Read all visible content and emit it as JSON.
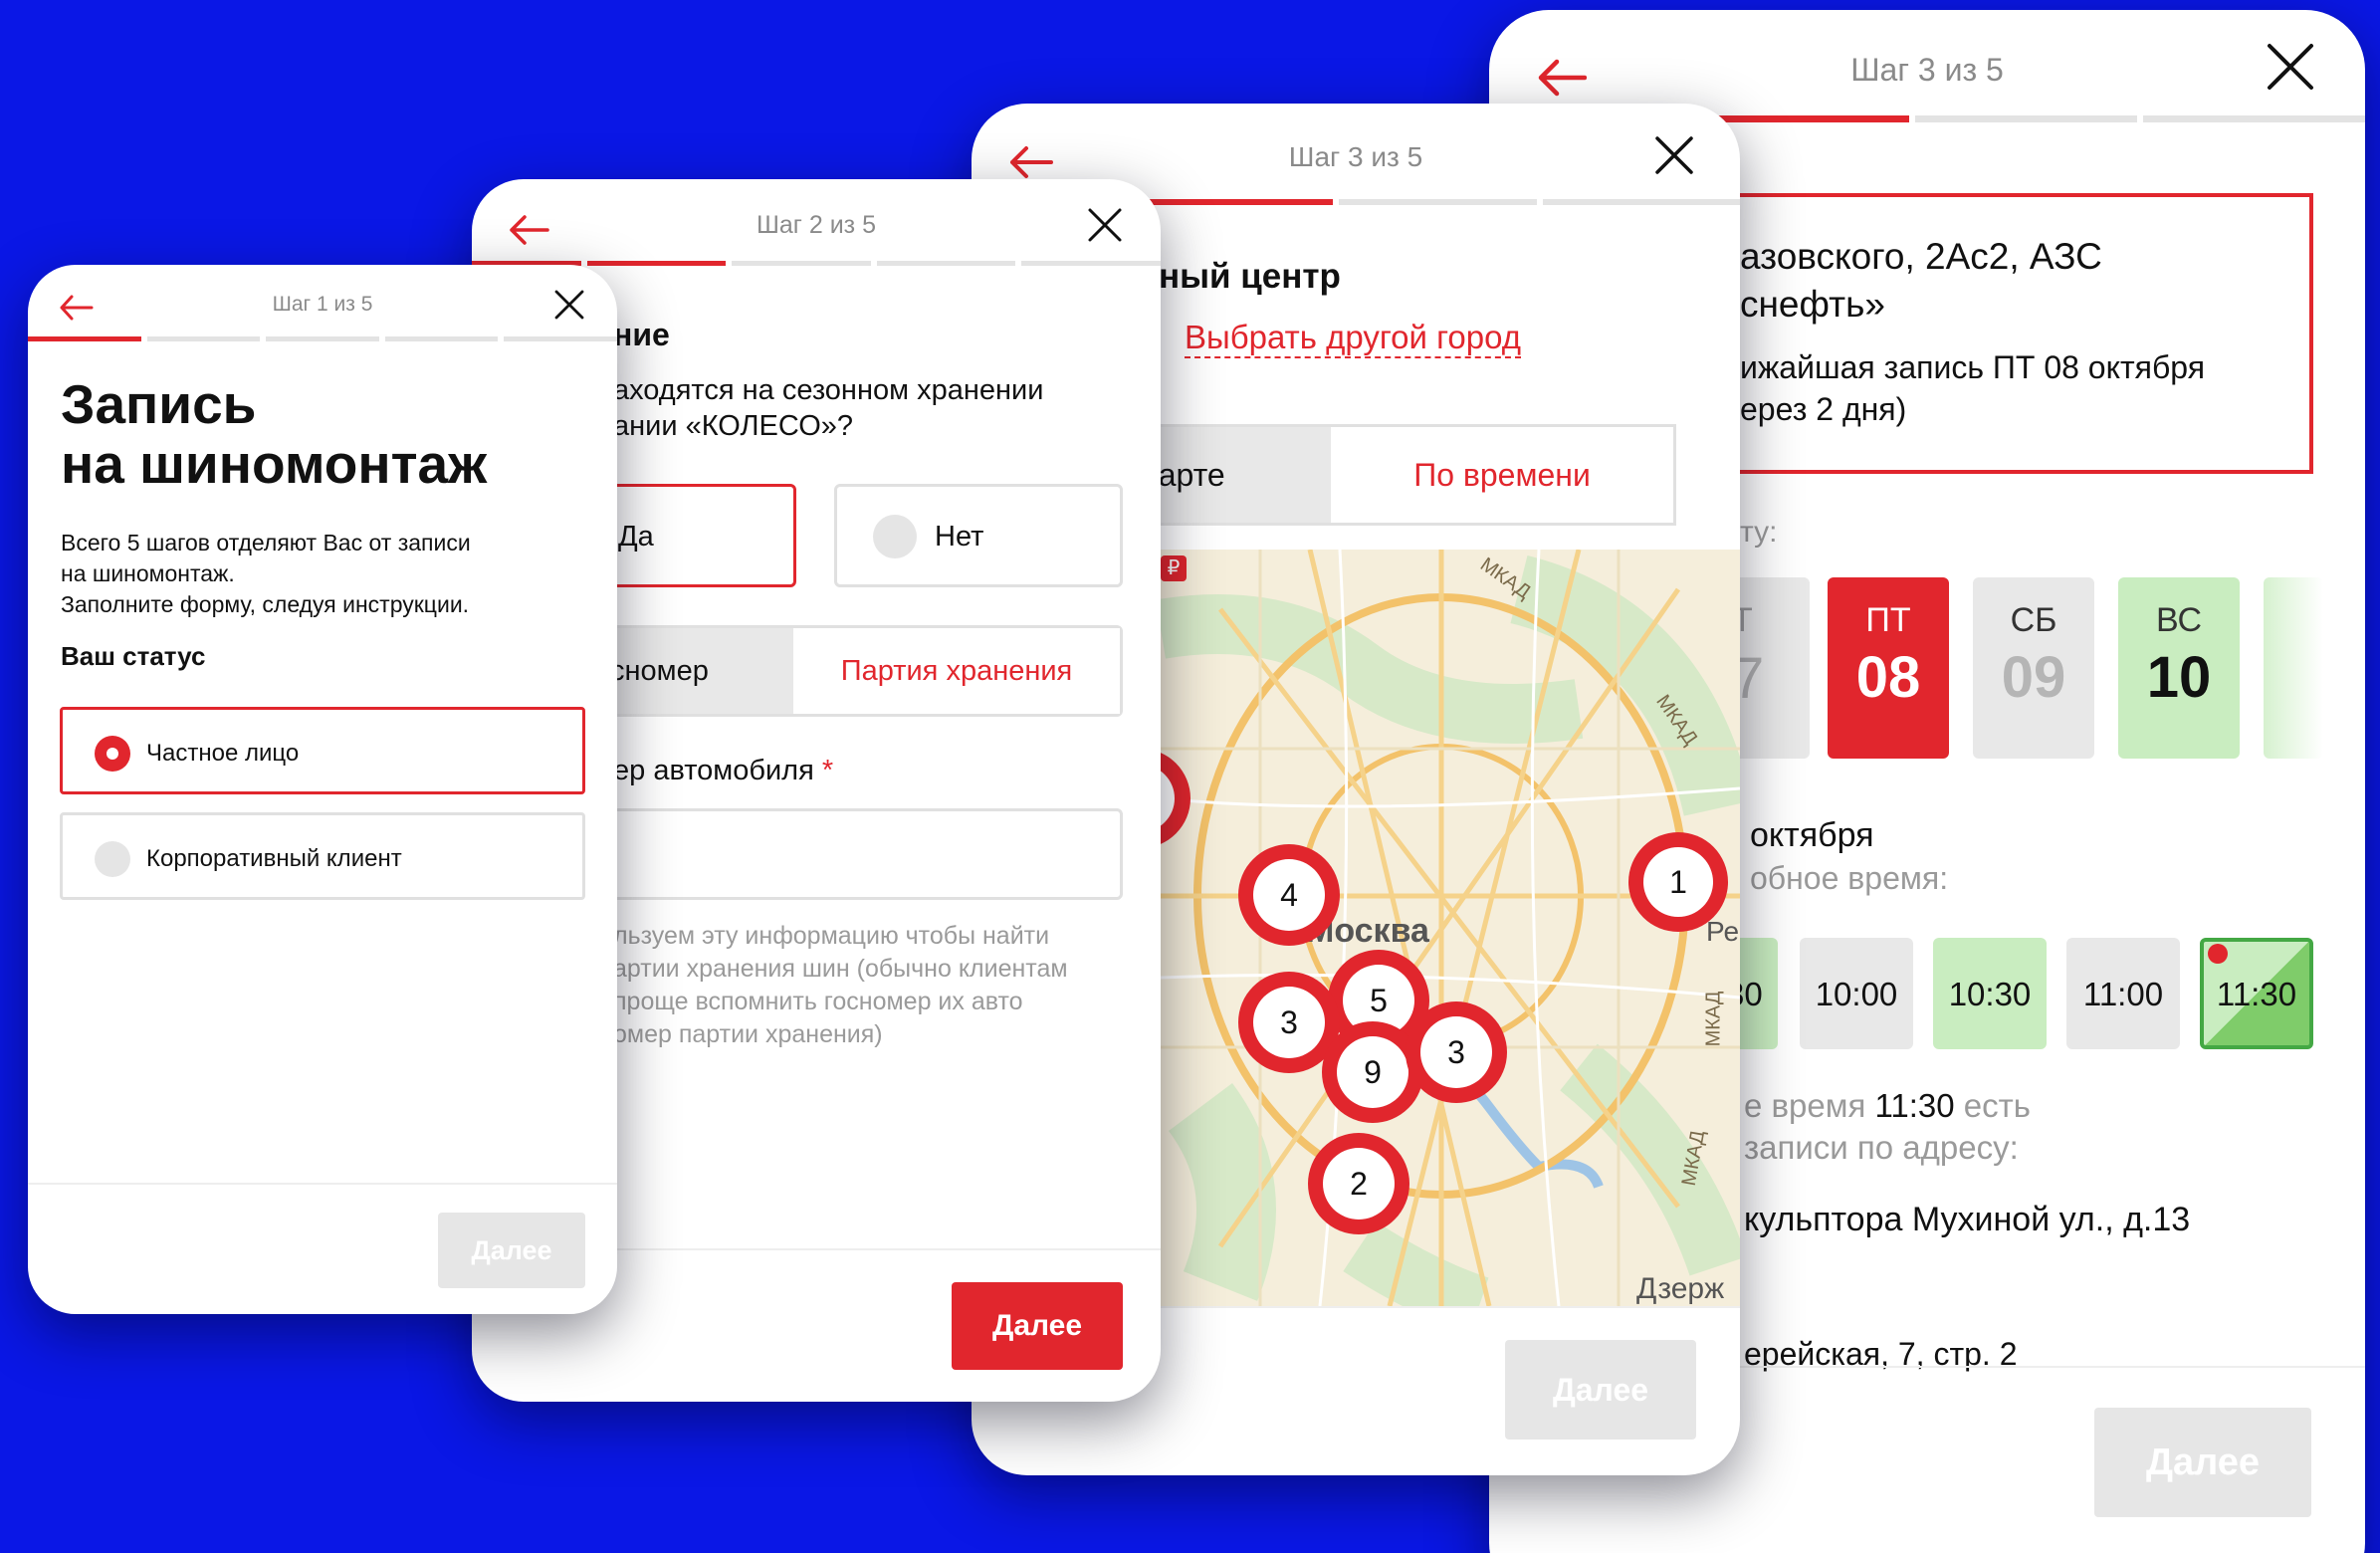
{
  "card1": {
    "step": "Шаг 1 из 5",
    "title_line1": "Запись",
    "title_line2": "на шиномонтаж",
    "desc_line1": "Всего 5 шагов отделяют Вас от записи",
    "desc_line2": "на шиномонтаж.",
    "desc_line3": "Заполните форму, следуя инструкции.",
    "status_label": "Ваш статус",
    "option_private": "Частное лицо",
    "option_corporate": "Корпоративный клиент",
    "next": "Далее"
  },
  "card2": {
    "step": "Шаг 2 из 5",
    "heading": "ние",
    "question_line1": "аходятся на сезонном хранении",
    "question_line2": "ании «КОЛЕСО»?",
    "yes": "Да",
    "no": "Нет",
    "tab_gosnomer": "сномер",
    "tab_party": "Партия хранения",
    "field_label": "ер автомобиля",
    "required_mark": "*",
    "hint_line1": "льзуем эту информацию чтобы найти",
    "hint_line2": "артии хранения шин (обычно клиентам",
    "hint_line3": "проще вспомнить госномер их авто",
    "hint_line4": "омер партии хранения)",
    "next": "Далее"
  },
  "card3": {
    "step": "Шаг 3 из 5",
    "heading": "ный центр",
    "other_city": "Выбрать другой город",
    "tab_map": "карте",
    "tab_time": "По времени",
    "map_city": "Москва",
    "map_mkad": "МКАД",
    "map_dzer": "Дзерж",
    "map_re": "Ре",
    "ruble_badge": "₽",
    "clusters": [
      "4",
      "1",
      "5",
      "3",
      "9",
      "3",
      "2"
    ],
    "next": "Далее"
  },
  "card4": {
    "step": "Шаг 3 из 5",
    "address_line1": "азовского, 2Ac2, АЗС",
    "address_line2": "снефть»",
    "nearest_line1": "ижайшая запись ПТ 08 октября",
    "nearest_line2": "ерез 2 дня)",
    "date_label": "ту:",
    "days": [
      {
        "dow": "Т",
        "num": "7"
      },
      {
        "dow": "ПТ",
        "num": "08"
      },
      {
        "dow": "СБ",
        "num": "09"
      },
      {
        "dow": "ВС",
        "num": "10"
      }
    ],
    "date_title": "октября",
    "time_label": "обное время:",
    "times": [
      "30",
      "10:00",
      "10:30",
      "11:00",
      "11:30"
    ],
    "info_line1_pre": "е время ",
    "info_line1_bold": "11:30",
    "info_line1_post": " есть",
    "info_line2": "записи по адресу:",
    "addr_a": "кульптора Мухиной ул., д.13",
    "addr_b": "ерейская, 7, стр. 2",
    "next": "Далее"
  },
  "colors": {
    "accent": "#e1262d",
    "background": "#0a17e6",
    "green": "#c9edc0"
  }
}
